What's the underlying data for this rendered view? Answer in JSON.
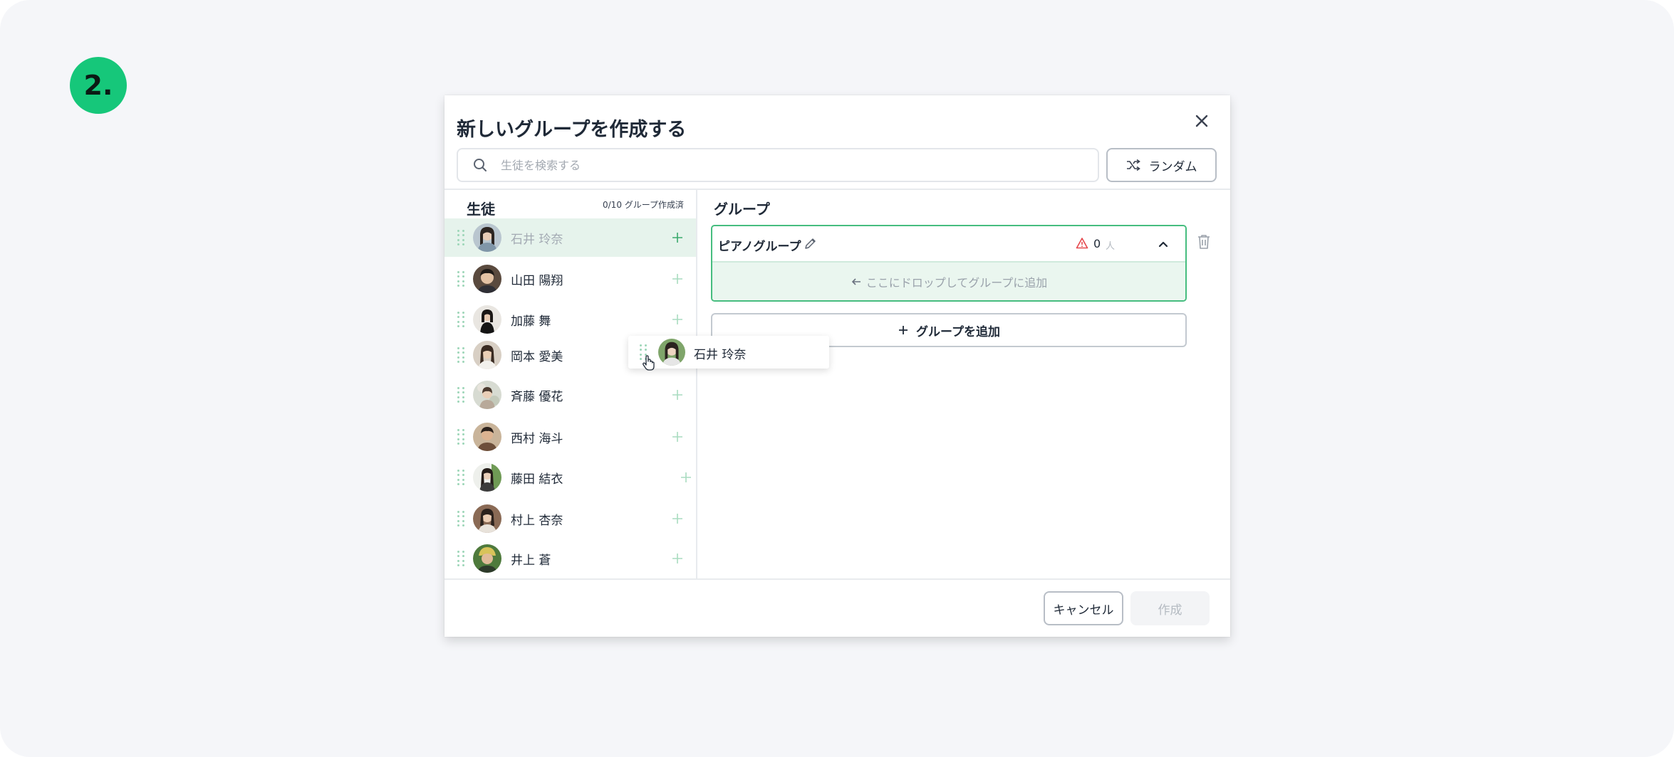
{
  "step_badge": "2.",
  "modal": {
    "title": "新しいグループを作成する",
    "search": {
      "placeholder": "生徒を検索する",
      "value": ""
    },
    "random_button": "ランダム",
    "cancel_button": "キャンセル",
    "create_button": "作成"
  },
  "students": {
    "title": "生徒",
    "count_label": "0/10 グループ作成済",
    "items": [
      {
        "name": "石井 玲奈",
        "state": "dragging"
      },
      {
        "name": "山田 陽翔"
      },
      {
        "name": "加藤 舞"
      },
      {
        "name": "岡本 愛美"
      },
      {
        "name": "斉藤 優花"
      },
      {
        "name": "西村 海斗"
      },
      {
        "name": "藤田 結衣"
      },
      {
        "name": "村上 杏奈"
      },
      {
        "name": "井上 蒼"
      }
    ]
  },
  "drag_ghost": {
    "name": "石井 玲奈"
  },
  "groups": {
    "title": "グループ",
    "items": [
      {
        "name": "ピアノグループ",
        "member_count": "0",
        "member_unit": "人",
        "drop_hint": "ここにドロップしてグループに追加"
      }
    ],
    "add_group_button": "グループを追加"
  },
  "colors": {
    "accent_green": "#46bd7f",
    "badge_green": "#16c77a",
    "drag_row_bg": "#e6f3ec",
    "warning_red": "#e5484d"
  },
  "icons": [
    "close-icon",
    "search-icon",
    "shuffle-icon",
    "drag-handle-icon",
    "plus-icon",
    "pencil-icon",
    "warning-icon",
    "chevron-up-icon",
    "trash-icon",
    "arrow-left-icon",
    "hand-cursor-icon"
  ]
}
